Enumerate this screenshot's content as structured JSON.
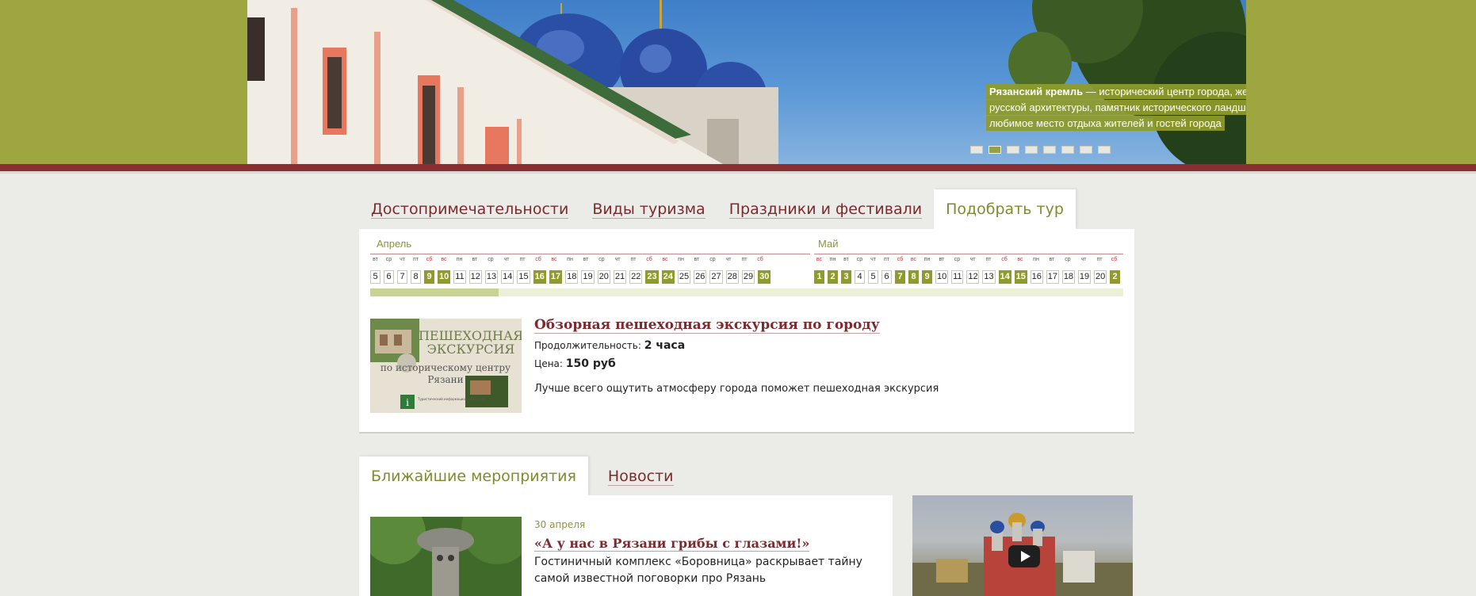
{
  "hero": {
    "caption_bold": "Рязанский кремль",
    "caption_text": " — исторический центр города, жемчужина русской архитектуры, памятник исторического ландшафта и любимое место отдыха жителей и гостей города",
    "slides": 8,
    "active_slide": 2
  },
  "tabs": [
    {
      "label": "Достопримечательности",
      "active": false
    },
    {
      "label": "Виды туризма",
      "active": false
    },
    {
      "label": "Праздники и фестивали",
      "active": false
    },
    {
      "label": "Подобрать тур",
      "active": true
    }
  ],
  "calendar": {
    "april": {
      "label": "Апрель",
      "weekdays": [
        "вт",
        "ср",
        "чт",
        "пт",
        "сб",
        "вс",
        "пн",
        "вт",
        "ср",
        "чт",
        "пт",
        "сб",
        "вс",
        "пн",
        "вт",
        "ср",
        "чт",
        "пт",
        "сб",
        "вс",
        "пн",
        "вт",
        "ср",
        "чт",
        "пт",
        "сб"
      ],
      "dates": [
        "5",
        "6",
        "7",
        "8",
        "9",
        "10",
        "11",
        "12",
        "13",
        "14",
        "15",
        "16",
        "17",
        "18",
        "19",
        "20",
        "21",
        "22",
        "23",
        "24",
        "25",
        "26",
        "27",
        "28",
        "29",
        "30"
      ],
      "highlighted": [
        "9",
        "10",
        "16",
        "17",
        "23",
        "24",
        "30"
      ]
    },
    "may": {
      "label": "Май",
      "weekdays": [
        "вс",
        "пн",
        "вт",
        "ср",
        "чт",
        "пт",
        "сб",
        "вс",
        "пн",
        "вт",
        "ср",
        "чт",
        "пт",
        "сб",
        "вс",
        "пн",
        "вт",
        "ср",
        "чт",
        "пт",
        "сб"
      ],
      "dates": [
        "1",
        "2",
        "3",
        "4",
        "5",
        "6",
        "7",
        "8",
        "9",
        "10",
        "11",
        "12",
        "13",
        "14",
        "15",
        "16",
        "17",
        "18",
        "19",
        "20",
        "2"
      ],
      "highlighted": [
        "1",
        "2",
        "3",
        "7",
        "8",
        "9",
        "14",
        "15",
        "2"
      ]
    },
    "scroll_fraction": 0.17
  },
  "tour": {
    "title": "Обзорная пешеходная экскурсия по городу",
    "duration_label": "Продолжительность:",
    "duration_value": "2 часа",
    "price_label": "Цена:",
    "price_value": "150 руб",
    "description": "Лучше всего ощутить атмосферу города поможет пешеходная экскурсия",
    "image_text": {
      "line1": "ПЕШЕХОДНАЯ",
      "line2": "ЭКСКУРСИЯ",
      "line3": "по историческому центру",
      "line4": "Рязани",
      "info": "Туристический информационный центр"
    }
  },
  "bottom_tabs": [
    {
      "label": "Ближайшие мероприятия",
      "active": true
    },
    {
      "label": "Новости",
      "active": false
    }
  ],
  "event": {
    "date": "30 апреля",
    "title": "«А у нас в Рязани грибы с глазами!»",
    "description": "Гостиничный комплекс «Боровница» раскрывает тайну самой известной поговорки про Рязань"
  },
  "colors": {
    "olive": "#9ea640",
    "accent_green": "#8f9b2c",
    "burgundy": "#7a2b30",
    "background": "#ebebe7"
  }
}
